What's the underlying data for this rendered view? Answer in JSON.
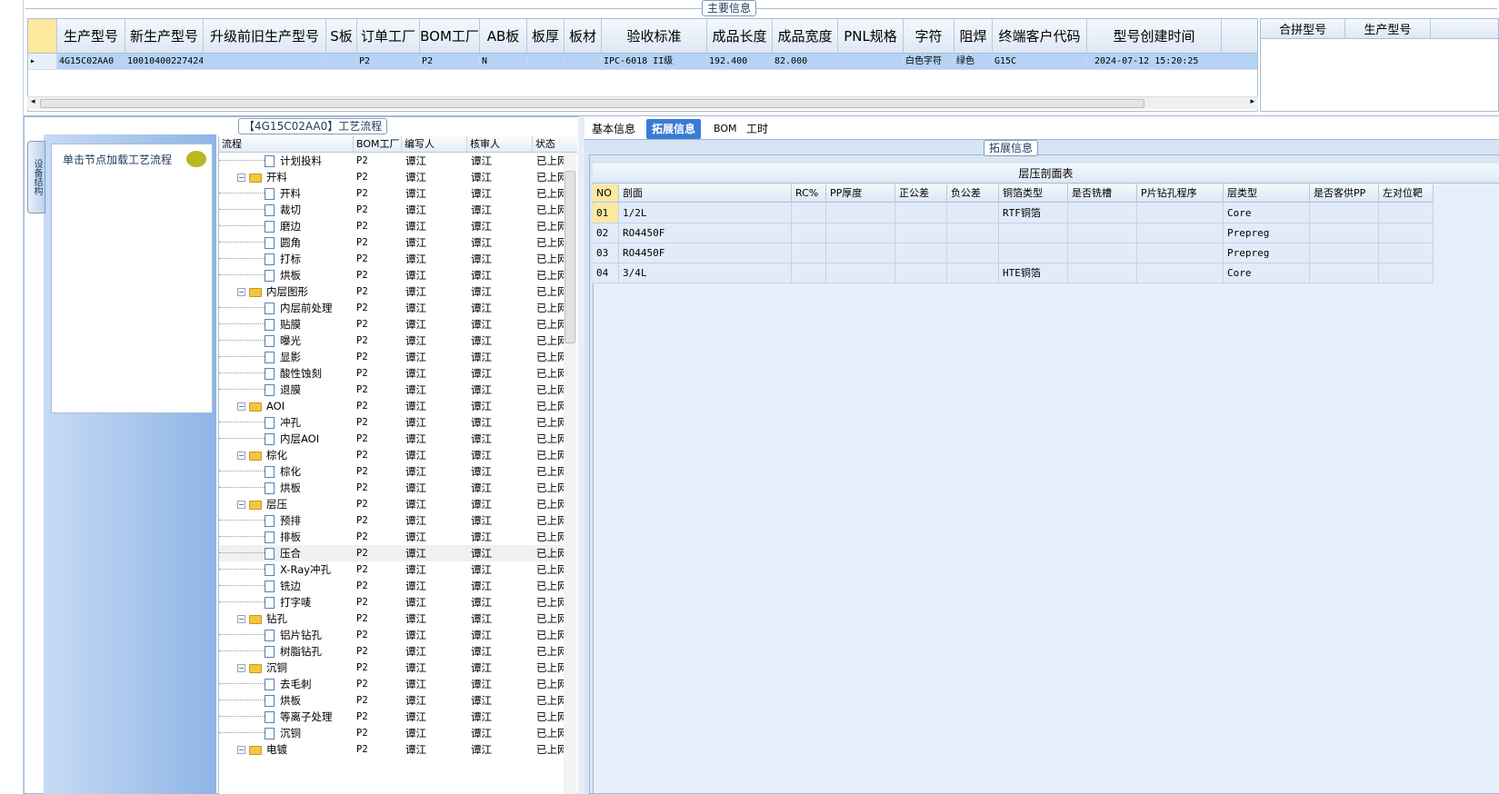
{
  "main_info": {
    "group_title": "主要信息",
    "columns": [
      "生产型号",
      "新生产型号",
      "升级前旧生产型号",
      "S板",
      "订单工厂",
      "BOM工厂",
      "AB板",
      "板厚",
      "板材",
      "验收标准",
      "成品长度",
      "成品宽度",
      "PNL规格",
      "字符",
      "阻焊",
      "终端客户代码",
      "型号创建时间"
    ],
    "row": [
      "4G15C02AA0",
      "10010400227424",
      "",
      "",
      "P2",
      "P2",
      "N",
      "",
      "",
      "IPC-6018 II级",
      "192.400",
      "82.000",
      "",
      "白色字符",
      "绿色",
      "G15C",
      "2024-07-12 15:20:25"
    ]
  },
  "side_grid": {
    "columns": [
      "合拼型号",
      "生产型号"
    ]
  },
  "process": {
    "group_title": "【4G15C02AA0】工艺流程",
    "vertical_tab": "设备结构",
    "hint": "单击节点加载工艺流程",
    "columns": [
      "流程",
      "BOM工厂",
      "编写人",
      "核审人",
      "状态"
    ],
    "rows": [
      {
        "name": "计划投料",
        "level": 2,
        "type": "doc",
        "bom": "P2",
        "writer": "谭江",
        "reviewer": "谭江",
        "status": "已上网"
      },
      {
        "name": "开料",
        "level": 1,
        "type": "folder",
        "bom": "P2",
        "writer": "谭江",
        "reviewer": "谭江",
        "status": "已上网"
      },
      {
        "name": "开料",
        "level": 2,
        "type": "doc",
        "bom": "P2",
        "writer": "谭江",
        "reviewer": "谭江",
        "status": "已上网"
      },
      {
        "name": "裁切",
        "level": 2,
        "type": "doc",
        "bom": "P2",
        "writer": "谭江",
        "reviewer": "谭江",
        "status": "已上网"
      },
      {
        "name": "磨边",
        "level": 2,
        "type": "doc",
        "bom": "P2",
        "writer": "谭江",
        "reviewer": "谭江",
        "status": "已上网"
      },
      {
        "name": "圆角",
        "level": 2,
        "type": "doc",
        "bom": "P2",
        "writer": "谭江",
        "reviewer": "谭江",
        "status": "已上网"
      },
      {
        "name": "打标",
        "level": 2,
        "type": "doc",
        "bom": "P2",
        "writer": "谭江",
        "reviewer": "谭江",
        "status": "已上网"
      },
      {
        "name": "烘板",
        "level": 2,
        "type": "doc",
        "bom": "P2",
        "writer": "谭江",
        "reviewer": "谭江",
        "status": "已上网"
      },
      {
        "name": "内层图形",
        "level": 1,
        "type": "folder",
        "bom": "P2",
        "writer": "谭江",
        "reviewer": "谭江",
        "status": "已上网"
      },
      {
        "name": "内层前处理",
        "level": 2,
        "type": "doc",
        "bom": "P2",
        "writer": "谭江",
        "reviewer": "谭江",
        "status": "已上网"
      },
      {
        "name": "贴膜",
        "level": 2,
        "type": "doc",
        "bom": "P2",
        "writer": "谭江",
        "reviewer": "谭江",
        "status": "已上网"
      },
      {
        "name": "曝光",
        "level": 2,
        "type": "doc",
        "bom": "P2",
        "writer": "谭江",
        "reviewer": "谭江",
        "status": "已上网"
      },
      {
        "name": "显影",
        "level": 2,
        "type": "doc",
        "bom": "P2",
        "writer": "谭江",
        "reviewer": "谭江",
        "status": "已上网"
      },
      {
        "name": "酸性蚀刻",
        "level": 2,
        "type": "doc",
        "bom": "P2",
        "writer": "谭江",
        "reviewer": "谭江",
        "status": "已上网"
      },
      {
        "name": "退膜",
        "level": 2,
        "type": "doc",
        "bom": "P2",
        "writer": "谭江",
        "reviewer": "谭江",
        "status": "已上网"
      },
      {
        "name": "AOI",
        "level": 1,
        "type": "folder",
        "bom": "P2",
        "writer": "谭江",
        "reviewer": "谭江",
        "status": "已上网"
      },
      {
        "name": "冲孔",
        "level": 2,
        "type": "doc",
        "bom": "P2",
        "writer": "谭江",
        "reviewer": "谭江",
        "status": "已上网"
      },
      {
        "name": "内层AOI",
        "level": 2,
        "type": "doc",
        "bom": "P2",
        "writer": "谭江",
        "reviewer": "谭江",
        "status": "已上网"
      },
      {
        "name": "棕化",
        "level": 1,
        "type": "folder",
        "bom": "P2",
        "writer": "谭江",
        "reviewer": "谭江",
        "status": "已上网"
      },
      {
        "name": "棕化",
        "level": 2,
        "type": "doc",
        "bom": "P2",
        "writer": "谭江",
        "reviewer": "谭江",
        "status": "已上网"
      },
      {
        "name": "烘板",
        "level": 2,
        "type": "doc",
        "bom": "P2",
        "writer": "谭江",
        "reviewer": "谭江",
        "status": "已上网"
      },
      {
        "name": "层压",
        "level": 1,
        "type": "folder",
        "bom": "P2",
        "writer": "谭江",
        "reviewer": "谭江",
        "status": "已上网"
      },
      {
        "name": "预排",
        "level": 2,
        "type": "doc",
        "bom": "P2",
        "writer": "谭江",
        "reviewer": "谭江",
        "status": "已上网"
      },
      {
        "name": "排板",
        "level": 2,
        "type": "doc",
        "bom": "P2",
        "writer": "谭江",
        "reviewer": "谭江",
        "status": "已上网"
      },
      {
        "name": "压合",
        "level": 2,
        "type": "doc",
        "bom": "P2",
        "writer": "谭江",
        "reviewer": "谭江",
        "status": "已上网",
        "selected": true
      },
      {
        "name": "X-Ray冲孔",
        "level": 2,
        "type": "doc",
        "bom": "P2",
        "writer": "谭江",
        "reviewer": "谭江",
        "status": "已上网"
      },
      {
        "name": "铣边",
        "level": 2,
        "type": "doc",
        "bom": "P2",
        "writer": "谭江",
        "reviewer": "谭江",
        "status": "已上网"
      },
      {
        "name": "打字唛",
        "level": 2,
        "type": "doc",
        "bom": "P2",
        "writer": "谭江",
        "reviewer": "谭江",
        "status": "已上网"
      },
      {
        "name": "钻孔",
        "level": 1,
        "type": "folder",
        "bom": "P2",
        "writer": "谭江",
        "reviewer": "谭江",
        "status": "已上网"
      },
      {
        "name": "铝片钻孔",
        "level": 2,
        "type": "doc",
        "bom": "P2",
        "writer": "谭江",
        "reviewer": "谭江",
        "status": "已上网"
      },
      {
        "name": "树脂钻孔",
        "level": 2,
        "type": "doc",
        "bom": "P2",
        "writer": "谭江",
        "reviewer": "谭江",
        "status": "已上网"
      },
      {
        "name": "沉铜",
        "level": 1,
        "type": "folder",
        "bom": "P2",
        "writer": "谭江",
        "reviewer": "谭江",
        "status": "已上网"
      },
      {
        "name": "去毛刺",
        "level": 2,
        "type": "doc",
        "bom": "P2",
        "writer": "谭江",
        "reviewer": "谭江",
        "status": "已上网"
      },
      {
        "name": "烘板",
        "level": 2,
        "type": "doc",
        "bom": "P2",
        "writer": "谭江",
        "reviewer": "谭江",
        "status": "已上网"
      },
      {
        "name": "等离子处理",
        "level": 2,
        "type": "doc",
        "bom": "P2",
        "writer": "谭江",
        "reviewer": "谭江",
        "status": "已上网"
      },
      {
        "name": "沉铜",
        "level": 2,
        "type": "doc",
        "bom": "P2",
        "writer": "谭江",
        "reviewer": "谭江",
        "status": "已上网"
      },
      {
        "name": "电镀",
        "level": 1,
        "type": "folder",
        "bom": "P2",
        "writer": "谭江",
        "reviewer": "谭江",
        "status": "已上网"
      }
    ]
  },
  "detail": {
    "tabs": [
      "基本信息",
      "拓展信息",
      "BOM",
      "工时"
    ],
    "active_tab": "拓展信息",
    "group_title": "拓展信息",
    "stack_title": "层压剖面表",
    "columns": [
      "NO",
      "剖面",
      "RC%",
      "PP厚度",
      "正公差",
      "负公差",
      "铜箔类型",
      "是否铣槽",
      "P片钻孔程序",
      "层类型",
      "是否客供PP",
      "左对位靶"
    ],
    "rows": [
      [
        "01",
        "1/2L",
        "",
        "",
        "",
        "",
        "RTF铜箔",
        "",
        "",
        "Core",
        "",
        ""
      ],
      [
        "02",
        "RO4450F",
        "",
        "",
        "",
        "",
        "",
        "",
        "",
        "Prepreg",
        "",
        ""
      ],
      [
        "03",
        "RO4450F",
        "",
        "",
        "",
        "",
        "",
        "",
        "",
        "Prepreg",
        "",
        ""
      ],
      [
        "04",
        "3/4L",
        "",
        "",
        "",
        "",
        "HTE铜箔",
        "",
        "",
        "Core",
        "",
        ""
      ]
    ]
  }
}
